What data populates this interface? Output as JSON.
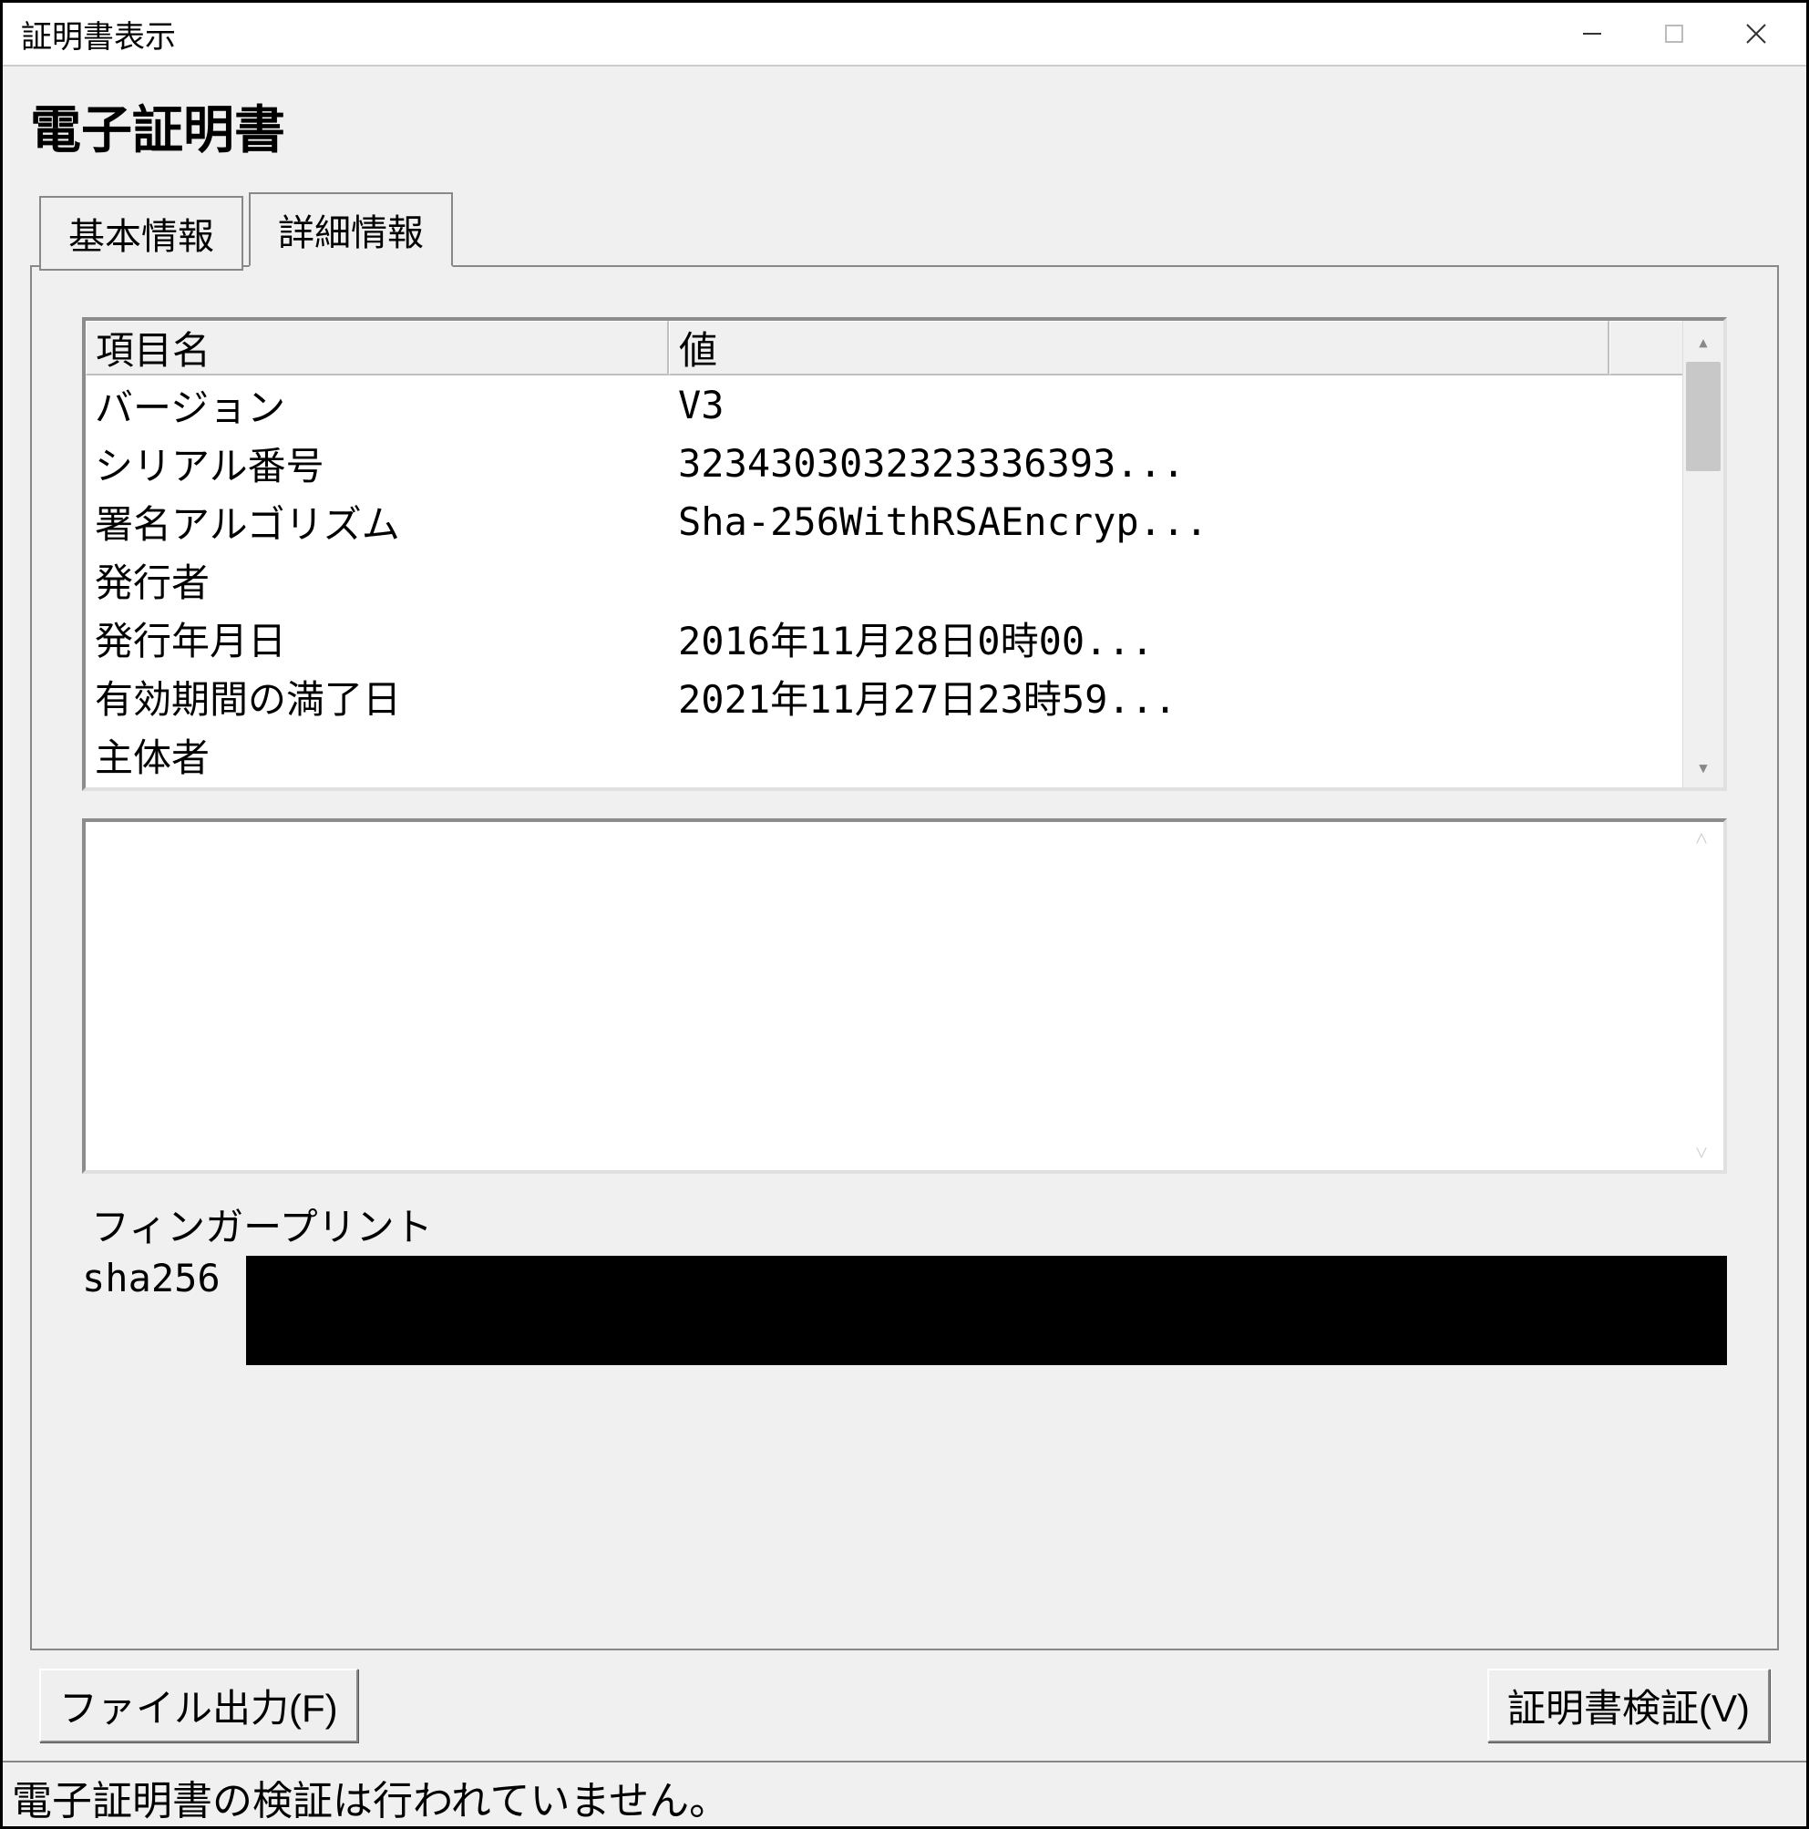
{
  "window": {
    "title": "証明書表示"
  },
  "heading": "電子証明書",
  "tabs": {
    "basic": "基本情報",
    "detail": "詳細情報",
    "active": "detail"
  },
  "listview": {
    "headers": {
      "name": "項目名",
      "value": "値"
    },
    "rows": [
      {
        "name": "バージョン",
        "value": "V3",
        "redacted": false
      },
      {
        "name": "シリアル番号",
        "value": "3234303032323336393...",
        "redacted": false
      },
      {
        "name": "署名アルゴリズム",
        "value": "Sha-256WithRSAEncryp...",
        "redacted": false
      },
      {
        "name": "発行者",
        "value": "",
        "redacted": true
      },
      {
        "name": "発行年月日",
        "value": "2016年11月28日0時00...",
        "redacted": false
      },
      {
        "name": "有効期間の満了日",
        "value": "2021年11月27日23時59...",
        "redacted": false
      },
      {
        "name": "主体者",
        "value": "",
        "redacted": true
      }
    ]
  },
  "fingerprint": {
    "label": "フィンガープリント",
    "algo": "sha256",
    "value_redacted": true
  },
  "buttons": {
    "export": "ファイル出力(F)",
    "verify": "証明書検証(V)"
  },
  "status": "電子証明書の検証は行われていません。"
}
